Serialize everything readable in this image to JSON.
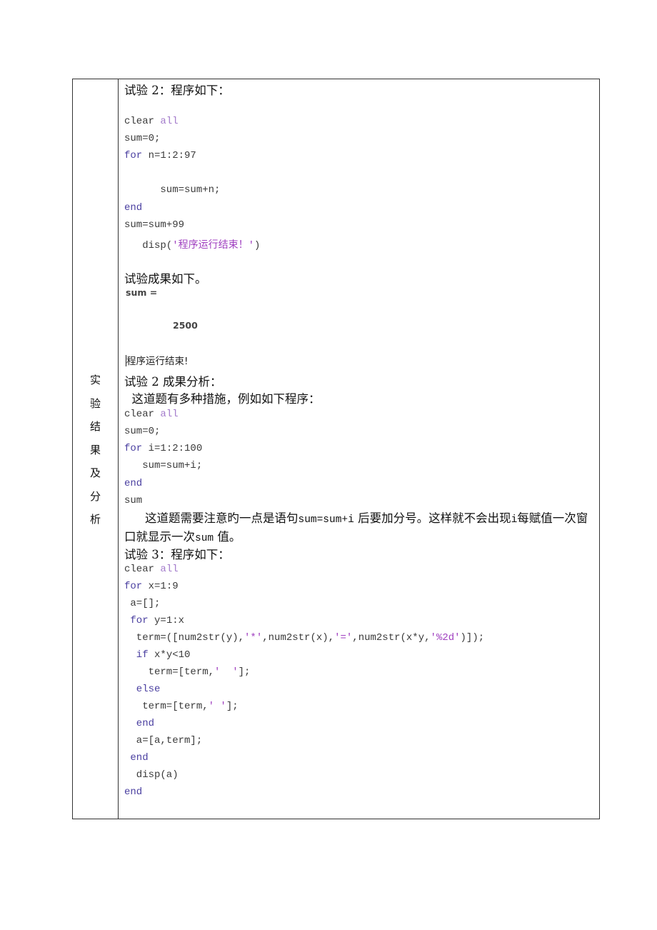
{
  "side_label": [
    "实",
    "验",
    "结",
    "果",
    "及",
    "分",
    "析"
  ],
  "exp2": {
    "heading": "试验 2：程序如下：",
    "code": {
      "l1_a": "clear ",
      "l1_b": "all",
      "l2": "sum=0;",
      "l3_a": "for",
      "l3_b": " n=1:2:97",
      "l4": "      sum=sum+n;",
      "l5": "end",
      "l6": "sum=sum+99",
      "l7_a": "   disp(",
      "l7_b": "'程序运行结束！'",
      "l7_c": ")"
    },
    "result_heading": "试验成果如下。",
    "output": {
      "sum_label": "sum =",
      "sum_value": "2500",
      "message": "程序运行结束!"
    },
    "analysis_heading": "试验 2 成果分析：",
    "analysis_intro": "  这道题有多种措施，例如如下程序：",
    "alt_code": {
      "l1_a": "clear ",
      "l1_b": "all",
      "l2": "sum=0;",
      "l3_a": "for",
      "l3_b": " i=1:2:100",
      "l4": "   sum=sum+i;",
      "l5": "end",
      "l6": "sum"
    },
    "note_p1": "这道题需要注意旳一点是语句",
    "note_code1": "sum=sum+i",
    "note_p2": " 后要加分号。这样就不会出现",
    "note_code2": "i",
    "note_p3": "每赋值一次窗口就显示一次",
    "note_code3": "sum",
    "note_p4": " 值。"
  },
  "exp3": {
    "heading": "试验 3：程序如下：",
    "code": {
      "l1_a": "clear ",
      "l1_b": "all",
      "l2_a": "for",
      "l2_b": " x=1:9",
      "l3": " a=[];",
      "l4_a": " for",
      "l4_b": " y=1:x",
      "l5_a": "  term=([num2str(y),",
      "l5_b": "'*'",
      "l5_c": ",num2str(x),",
      "l5_d": "'='",
      "l5_e": ",num2str(x*y,",
      "l5_f": "'%2d'",
      "l5_g": ")]);",
      "l6_a": "  if",
      "l6_b": " x*y<10",
      "l7_a": "    term=[term,",
      "l7_b": "'  '",
      "l7_c": "];",
      "l8": "  else",
      "l9_a": "   term=[term,",
      "l9_b": "' '",
      "l9_c": "];",
      "l10": "  end",
      "l11": "  a=[a,term];",
      "l12": " end",
      "l13": "  disp(a)",
      "l14": "end"
    }
  },
  "colors": {
    "keyword": "#4a3fa0",
    "all": "#a37bcb",
    "string": "#a040c0",
    "code": "#3a3a3a",
    "border": "#333333"
  }
}
